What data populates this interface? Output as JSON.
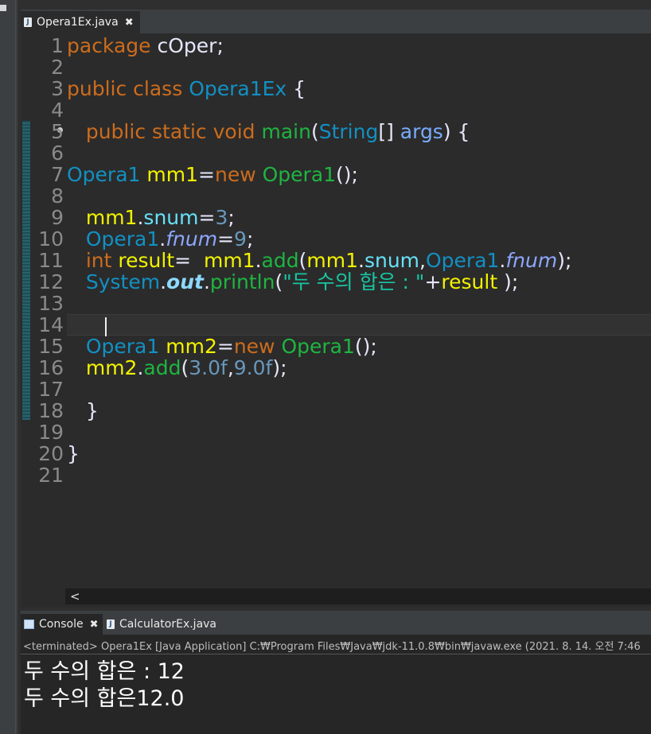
{
  "editor": {
    "tab": {
      "icon": "java-file-icon",
      "label": "Opera1Ex.java",
      "close": "✖"
    },
    "line_numbers": [
      "1",
      "2",
      "3",
      "4",
      "5",
      "6",
      "7",
      "8",
      "9",
      "10",
      "11",
      "12",
      "13",
      "14",
      "15",
      "16",
      "17",
      "18",
      "19",
      "20",
      "21"
    ],
    "code": {
      "l1": {
        "kw": "package",
        "name": " cOper;"
      },
      "l3": {
        "kw": "public class",
        "cls": "Opera1Ex",
        "brace": " {"
      },
      "l5": {
        "kw": "public static void",
        "fn": "main",
        "open": "(",
        "type": "String",
        "arr": "[] ",
        "param": "args",
        "close": ") {"
      },
      "l7": {
        "cls": "Opera1",
        "var": "mm1",
        "eq": "=",
        "kw": "new",
        "cls2": "Opera1",
        "end": "();"
      },
      "l9": {
        "var": "mm1",
        "dot": ".",
        "fld": "snum",
        "eq": "=",
        "num": "3",
        "end": ";"
      },
      "l10": {
        "cls": "Opera1",
        "dot": ".",
        "fld": "fnum",
        "eq": "=",
        "num": "9",
        "end": ";"
      },
      "l11": {
        "kw": "int",
        "var": "result",
        "eq": "=  ",
        "obj": "mm1",
        "dot": ".",
        "fn": "add",
        "open": "(",
        "obj2": "mm1",
        "dot2": ".",
        "fld": "snum",
        "comma": ",",
        "cls": "Opera1",
        "dot3": ".",
        "fld2": "fnum",
        "end": ");"
      },
      "l12": {
        "cls": "System",
        "dot": ".",
        "out": "out",
        "dot2": ".",
        "fn": "println",
        "open": "(",
        "str": "\"두 수의 합은 : \"",
        "plus": "+",
        "var": "result",
        "end": " );"
      },
      "l15": {
        "cls": "Opera1",
        "var": "mm2",
        "eq": "=",
        "kw": "new",
        "cls2": "Opera1",
        "end": "();"
      },
      "l16": {
        "var": "mm2",
        "dot": ".",
        "fn": "add",
        "open": "(",
        "num1": "3.0f",
        "comma": ",",
        "num2": "9.0f",
        "end": ");"
      },
      "l18": {
        "brace": "}"
      },
      "l20": {
        "brace": "}"
      }
    },
    "scroll_left": "<"
  },
  "console": {
    "tabs": [
      {
        "label": "Console",
        "close": "✖"
      },
      {
        "label": "CalculatorEx.java"
      }
    ],
    "terminated_line": "<terminated> Opera1Ex [Java Application] C:₩Program Files₩Java₩jdk-11.0.8₩bin₩javaw.exe  (2021. 8. 14. 오전 7:46",
    "output": [
      "두 수의 합은 : 12",
      "두 수의 합은12.0"
    ]
  },
  "colors": {
    "background": "#2b2b2b",
    "keyword": "#cc6c1d",
    "class": "#1290c3",
    "method": "#1eb540",
    "variable": "#f2f200",
    "field": "#66e1f8",
    "string": "#17c6a3"
  }
}
